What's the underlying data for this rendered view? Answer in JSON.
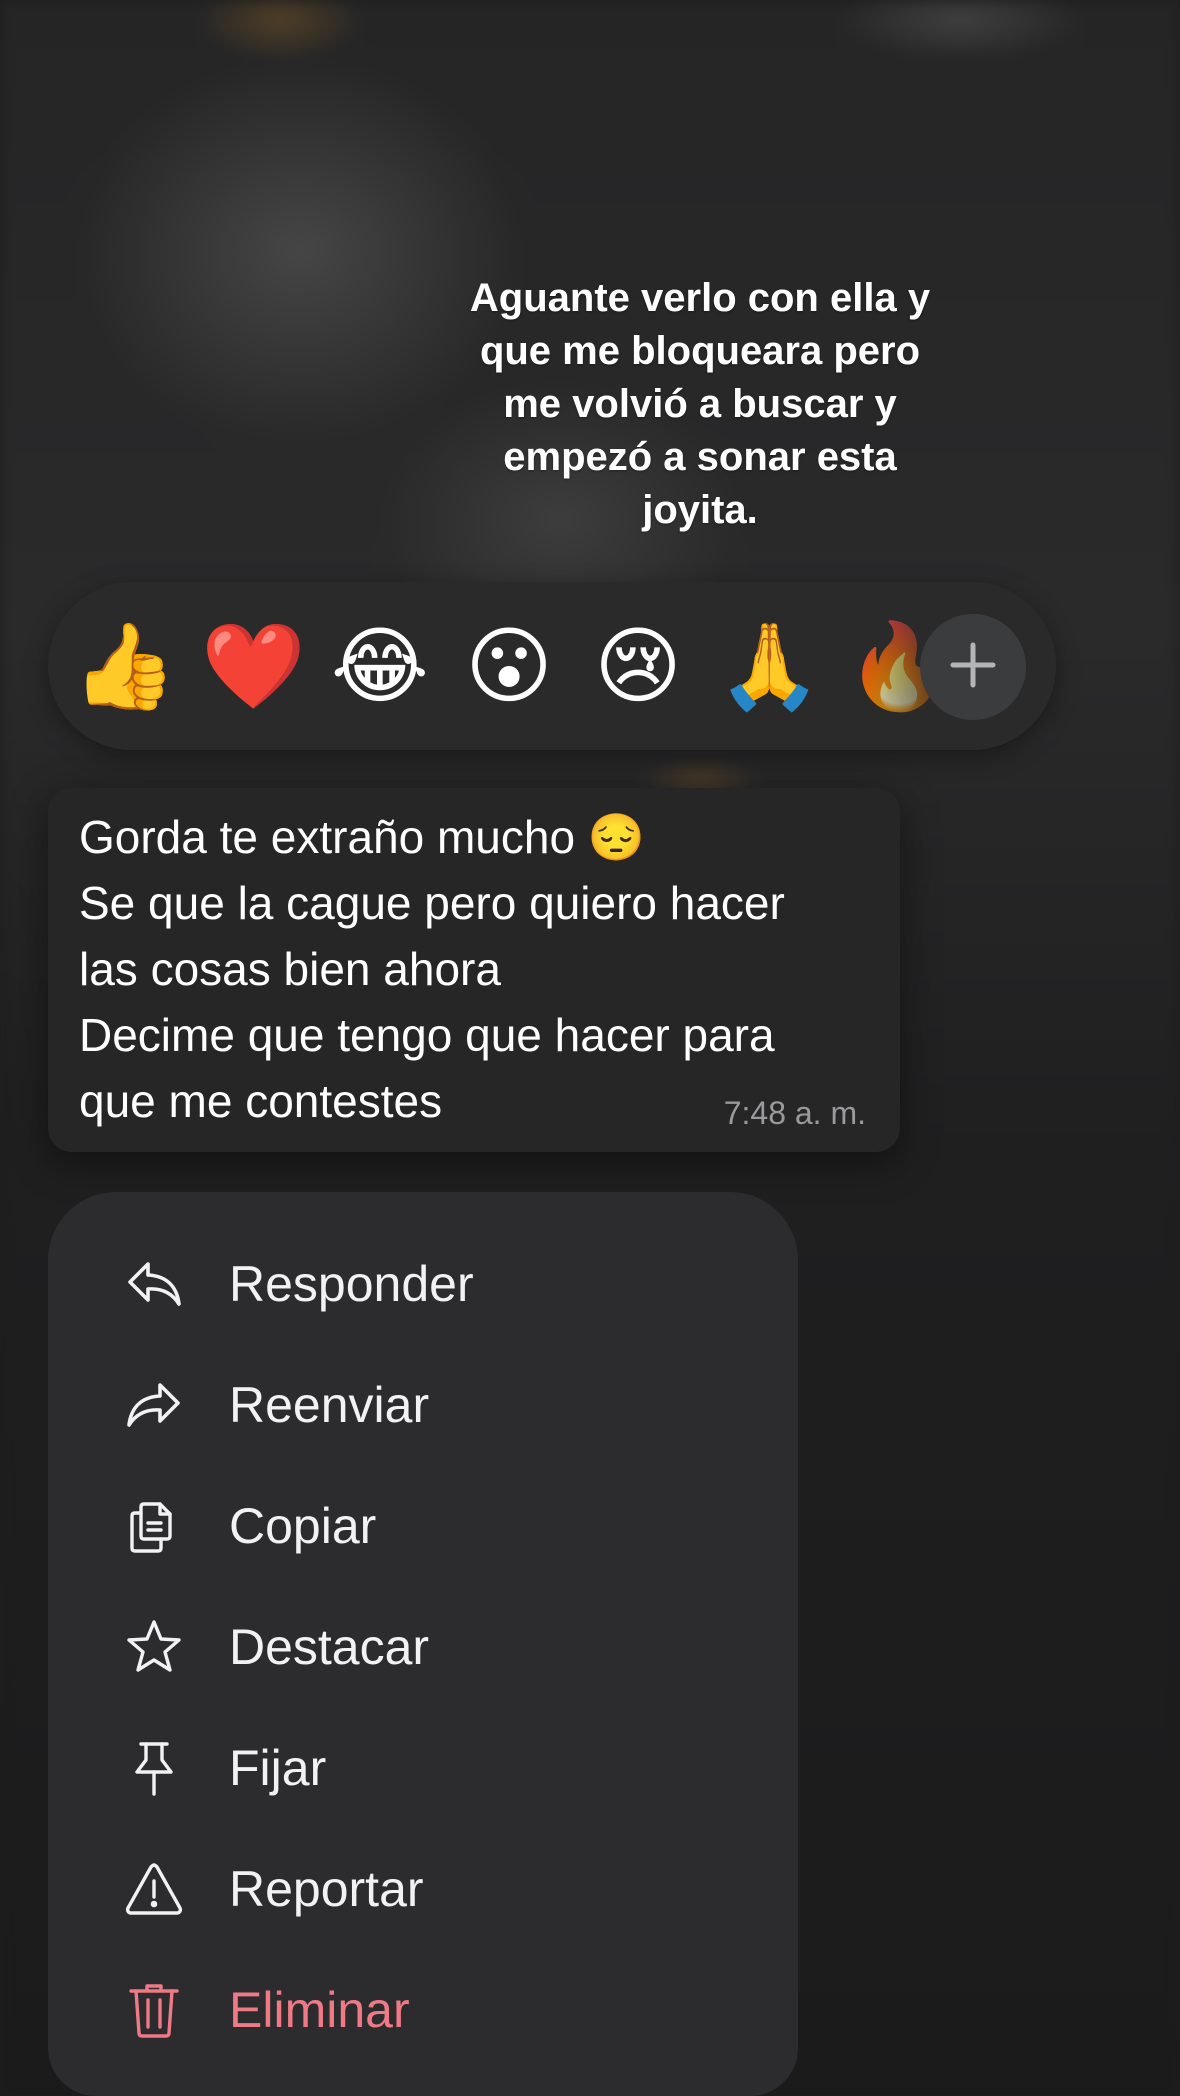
{
  "overlay_caption": "Aguante verlo con ella y\nque me bloqueara pero\nme volvió a buscar y\nempezó a sonar esta\njoyita.",
  "reactions": [
    {
      "emoji": "👍",
      "name": "thumbs-up"
    },
    {
      "emoji": "❤️",
      "name": "heart"
    },
    {
      "emoji": "😂",
      "name": "tears-of-joy"
    },
    {
      "emoji": "😮",
      "name": "surprised"
    },
    {
      "emoji": "😢",
      "name": "crying"
    },
    {
      "emoji": "🙏",
      "name": "praying-hands"
    },
    {
      "emoji": "🔥",
      "name": "fire"
    }
  ],
  "message": {
    "text": "Gorda te extraño mucho 😔\nSe que la cague pero quiero hacer\nlas cosas bien ahora\nDecime que tengo que hacer para\nque me contestes",
    "time": "7:48 a. m."
  },
  "menu": {
    "items": [
      {
        "label": "Responder",
        "icon": "reply-icon"
      },
      {
        "label": "Reenviar",
        "icon": "forward-icon"
      },
      {
        "label": "Copiar",
        "icon": "copy-icon"
      },
      {
        "label": "Destacar",
        "icon": "star-icon"
      },
      {
        "label": "Fijar",
        "icon": "pin-icon"
      },
      {
        "label": "Reportar",
        "icon": "warning-icon"
      },
      {
        "label": "Eliminar",
        "icon": "trash-icon"
      }
    ]
  },
  "colors": {
    "menu_background": "#2c2c2e",
    "bubble_background": "#262627",
    "danger": "#ef7a86",
    "timestamp": "#9a9a9c"
  }
}
